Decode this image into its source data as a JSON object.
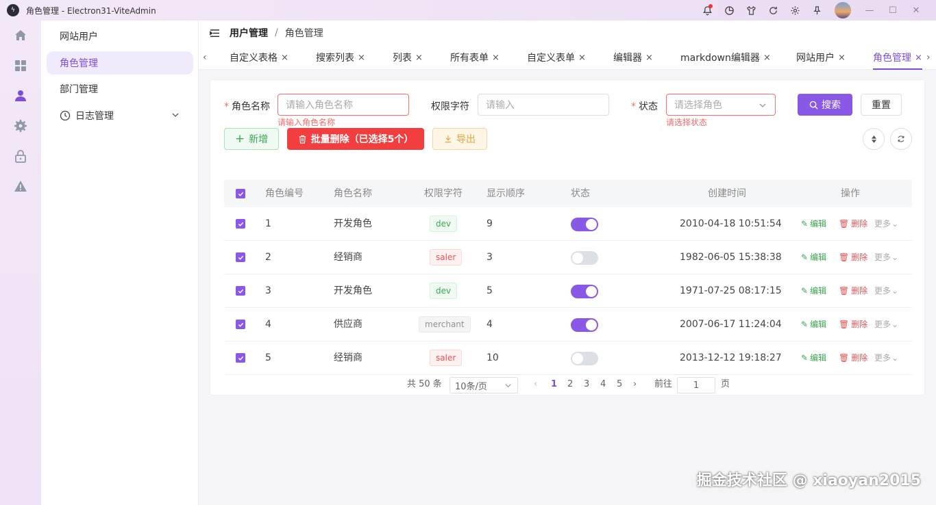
{
  "titlebar": {
    "app_title": "角色管理 - Electron31-ViteAdmin",
    "logo_text": "ϟ"
  },
  "rail": {
    "icons": [
      "home-icon",
      "dashboard-icon",
      "user-icon",
      "gear-icon",
      "lock-icon",
      "warning-icon"
    ]
  },
  "sidebar": {
    "items": [
      {
        "label": "网站用户"
      },
      {
        "label": "角色管理"
      },
      {
        "label": "部门管理"
      },
      {
        "label": "日志管理"
      }
    ]
  },
  "breadcrumb": {
    "parent": "用户管理",
    "sep": "/",
    "current": "角色管理"
  },
  "tabs": [
    {
      "label": "自定义表格"
    },
    {
      "label": "搜索列表"
    },
    {
      "label": "列表"
    },
    {
      "label": "所有表单"
    },
    {
      "label": "自定义表单"
    },
    {
      "label": "编辑器"
    },
    {
      "label": "markdown编辑器"
    },
    {
      "label": "网站用户"
    },
    {
      "label": "角色管理"
    }
  ],
  "tab_close": "×",
  "form": {
    "name_label": "角色名称",
    "name_placeholder": "请输入角色名称",
    "name_error": "请输入角色名称",
    "perm_label": "权限字符",
    "perm_placeholder": "请输入",
    "status_label": "状态",
    "status_placeholder": "请选择角色",
    "status_error": "请选择状态",
    "required_mark": "*",
    "search_btn": "搜索",
    "reset_btn": "重置"
  },
  "toolbar": {
    "add_btn": "新增",
    "batch_delete_btn": "批量删除（已选择5个）",
    "export_btn": "导出"
  },
  "table": {
    "headers": [
      "角色编号",
      "角色名称",
      "权限字符",
      "显示顺序",
      "状态",
      "创建时间",
      "操作"
    ],
    "rows": [
      {
        "id": "1",
        "name": "开发角色",
        "perm": "dev",
        "perm_type": "success",
        "order": "9",
        "status": true,
        "created": "2010-04-18 10:51:54"
      },
      {
        "id": "2",
        "name": "经销商",
        "perm": "saler",
        "perm_type": "danger",
        "order": "3",
        "status": false,
        "created": "1982-06-05 15:38:38"
      },
      {
        "id": "3",
        "name": "开发角色",
        "perm": "dev",
        "perm_type": "success",
        "order": "5",
        "status": true,
        "created": "1971-07-25 08:17:15"
      },
      {
        "id": "4",
        "name": "供应商",
        "perm": "merchant",
        "perm_type": "info",
        "order": "4",
        "status": true,
        "created": "2007-06-17 11:24:04"
      },
      {
        "id": "5",
        "name": "经销商",
        "perm": "saler",
        "perm_type": "danger",
        "order": "10",
        "status": false,
        "created": "2013-12-12 19:18:27"
      }
    ],
    "edit_label": "编辑",
    "delete_label": "删除",
    "more_label": "更多"
  },
  "pagination": {
    "total": "共 50 条",
    "page_size": "10条/页",
    "pages": [
      "1",
      "2",
      "3",
      "4",
      "5"
    ],
    "current_page": "1",
    "goto_label": "前往",
    "goto_value": "1",
    "goto_suffix": "页"
  },
  "watermark": "掘金技术社区 @ xiaoyan2015",
  "colors": {
    "primary": "#8a58e6",
    "danger": "#f56c6c",
    "success": "#3aa64f",
    "warning": "#e6a23c"
  }
}
